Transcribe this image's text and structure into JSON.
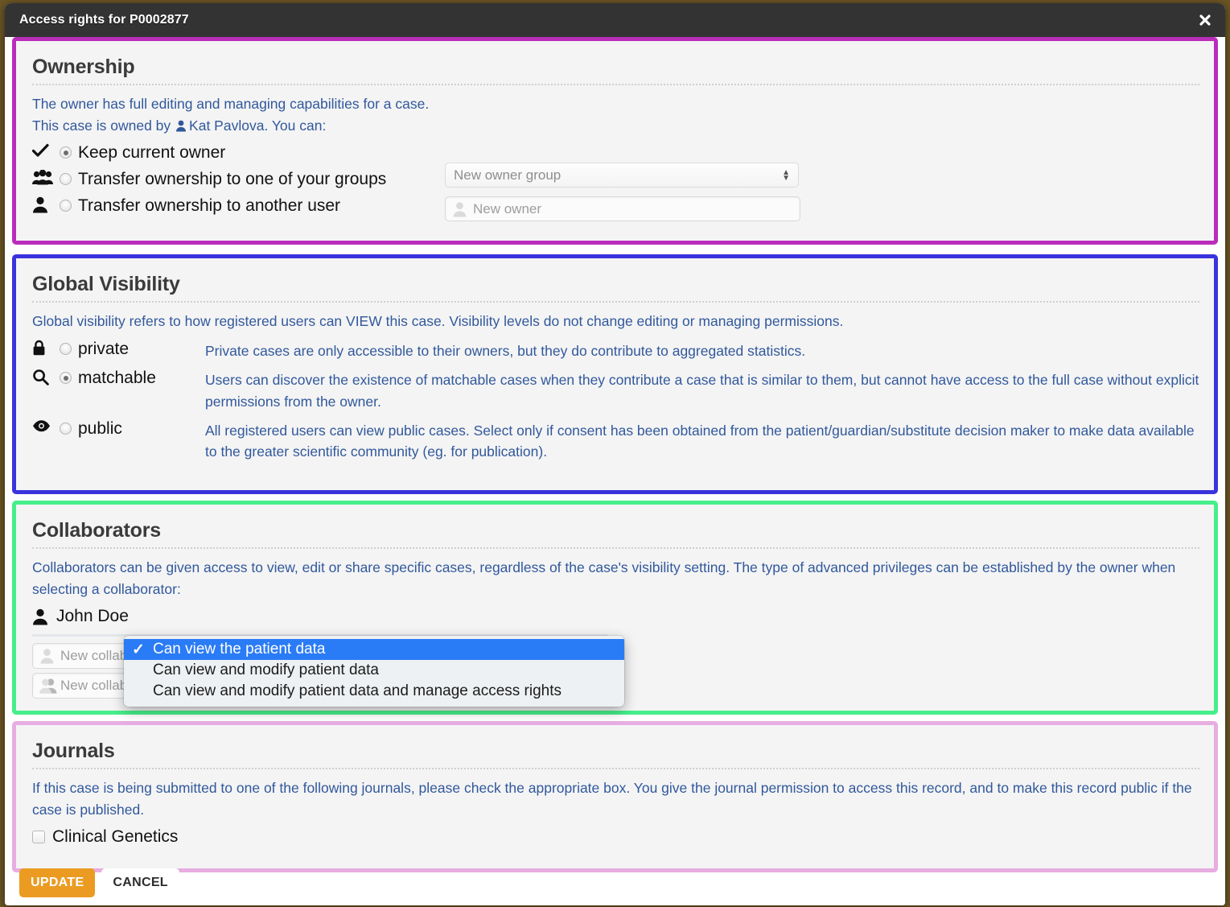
{
  "window": {
    "title": "Access rights for P0002877",
    "close_label": "✖"
  },
  "ownership": {
    "title": "Ownership",
    "desc_line1": "The owner has full editing and managing capabilities for a case.",
    "desc_line2_prefix": "This case is owned by",
    "owner_name": "Kat Pavlova",
    "desc_line2_suffix": ". You can:",
    "options": [
      {
        "icon": "check-icon",
        "label": "Keep current owner",
        "selected": true
      },
      {
        "icon": "users-group-icon",
        "label": "Transfer ownership to one of your groups",
        "selected": false
      },
      {
        "icon": "user-icon",
        "label": "Transfer ownership to another user",
        "selected": false
      }
    ],
    "group_select_value": "New owner group",
    "owner_input_placeholder": "New owner"
  },
  "visibility": {
    "title": "Global Visibility",
    "desc": "Global visibility refers to how registered users can VIEW this case. Visibility levels do not change editing or managing permissions.",
    "levels": [
      {
        "icon": "lock-icon",
        "label": "private",
        "selected": false,
        "desc": "Private cases are only accessible to their owners, but they do contribute to aggregated statistics."
      },
      {
        "icon": "search-icon",
        "label": "matchable",
        "selected": true,
        "desc": "Users can discover the existence of matchable cases when they contribute a case that is similar to them, but cannot have access to the full case without explicit permissions from the owner."
      },
      {
        "icon": "eye-icon",
        "label": "public",
        "selected": false,
        "desc": "All registered users can view public cases. Select only if consent has been obtained from the patient/guardian/substitute decision maker to make data available to the greater scientific community (eg. for publication)."
      }
    ]
  },
  "collaborators": {
    "title": "Collaborators",
    "desc": "Collaborators can be given access to view, edit or share specific cases, regardless of the case's visibility setting. The type of advanced privileges can be established by the owner when selecting a collaborator:",
    "existing": [
      {
        "icon": "user-icon",
        "name": "John Doe"
      }
    ],
    "new_collaborator_placeholder": "New collaborator",
    "new_group_placeholder": "New collaborating group",
    "dropdown": {
      "options": [
        {
          "label": "Can view the patient data",
          "selected": true
        },
        {
          "label": "Can view and modify patient data",
          "selected": false
        },
        {
          "label": "Can view and modify patient data and manage access rights",
          "selected": false
        }
      ],
      "check_glyph": "✓"
    }
  },
  "journals": {
    "title": "Journals",
    "desc": "If this case is being submitted to one of the following journals, please check the appropriate box. You give the journal permission to access this record, and to make this record public if the case is published.",
    "items": [
      {
        "label": "Clinical Genetics",
        "checked": false
      }
    ]
  },
  "footer": {
    "update_label": "UPDATE",
    "cancel_label": "CANCEL"
  },
  "colors": {
    "ownership_border": "#bb2cbb",
    "visibility_border": "#3a33dd",
    "collaborators_border": "#46ef8a",
    "journals_border": "#e7ade1",
    "link_blue": "#31589c",
    "accent_orange": "#eb9b22",
    "dropdown_highlight": "#2a7bf6",
    "titlebar": "#333333"
  }
}
